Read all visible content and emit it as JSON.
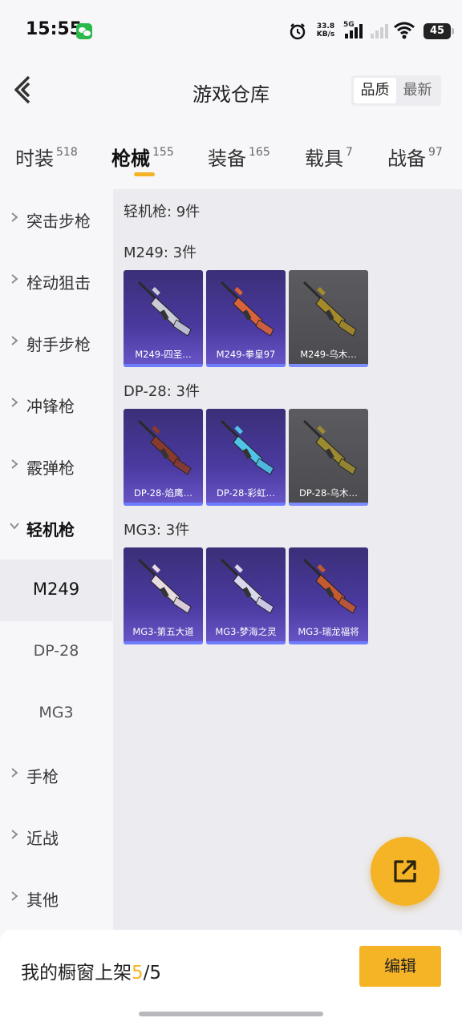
{
  "status_bar": {
    "time": "15:55",
    "net_speed_value": "33.8",
    "net_speed_unit": "KB/s",
    "network": "5G",
    "battery": "45"
  },
  "header": {
    "title": "游戏仓库",
    "sort_options": [
      "品质",
      "最新"
    ]
  },
  "tabs": [
    {
      "label": "时装",
      "count": "518"
    },
    {
      "label": "枪械",
      "count": "155",
      "active": true
    },
    {
      "label": "装备",
      "count": "165"
    },
    {
      "label": "载具",
      "count": "7"
    },
    {
      "label": "战备",
      "count": "97"
    }
  ],
  "sidebar": {
    "categories": [
      {
        "label": "突击步枪"
      },
      {
        "label": "栓动狙击"
      },
      {
        "label": "射手步枪"
      },
      {
        "label": "冲锋枪"
      },
      {
        "label": "霰弹枪"
      },
      {
        "label": "轻机枪",
        "expanded": true
      },
      {
        "label": "手枪"
      },
      {
        "label": "近战"
      },
      {
        "label": "其他"
      }
    ],
    "subitems": [
      {
        "label": "M249",
        "active": true
      },
      {
        "label": "DP-28"
      },
      {
        "label": "MG3"
      }
    ]
  },
  "content": {
    "summary": "轻机枪: 9件",
    "groups": [
      {
        "title": "M249: 3件",
        "items": [
          {
            "name": "M249-四圣…",
            "rarity": "purple",
            "gun_color": "#c9ccd6"
          },
          {
            "name": "M249-拳皇97",
            "rarity": "purple",
            "gun_color": "#d9623a"
          },
          {
            "name": "M249-乌木…",
            "rarity": "grey",
            "gun_color": "#a58a2a"
          }
        ]
      },
      {
        "title": "DP-28: 3件",
        "items": [
          {
            "name": "DP-28-焰鹰…",
            "rarity": "purple",
            "gun_color": "#8a3a2a"
          },
          {
            "name": "DP-28-彩虹…",
            "rarity": "purple",
            "gun_color": "#4fc4e8"
          },
          {
            "name": "DP-28-乌木…",
            "rarity": "grey",
            "gun_color": "#9b8a30"
          }
        ]
      },
      {
        "title": "MG3: 3件",
        "items": [
          {
            "name": "MG3-第五大道",
            "rarity": "purple",
            "gun_color": "#e8dce0"
          },
          {
            "name": "MG3-梦海之灵",
            "rarity": "purple",
            "gun_color": "#d8d8ee"
          },
          {
            "name": "MG3-瑞龙福将",
            "rarity": "purple",
            "gun_color": "#c45a32"
          }
        ]
      }
    ]
  },
  "bottom_bar": {
    "showcase_label": "我的橱窗上架",
    "showcase_current": "5",
    "showcase_total": "/5",
    "edit_label": "编辑"
  },
  "icons": {
    "accent_color": "#f5b326",
    "fab_icon": "share-out-icon"
  }
}
